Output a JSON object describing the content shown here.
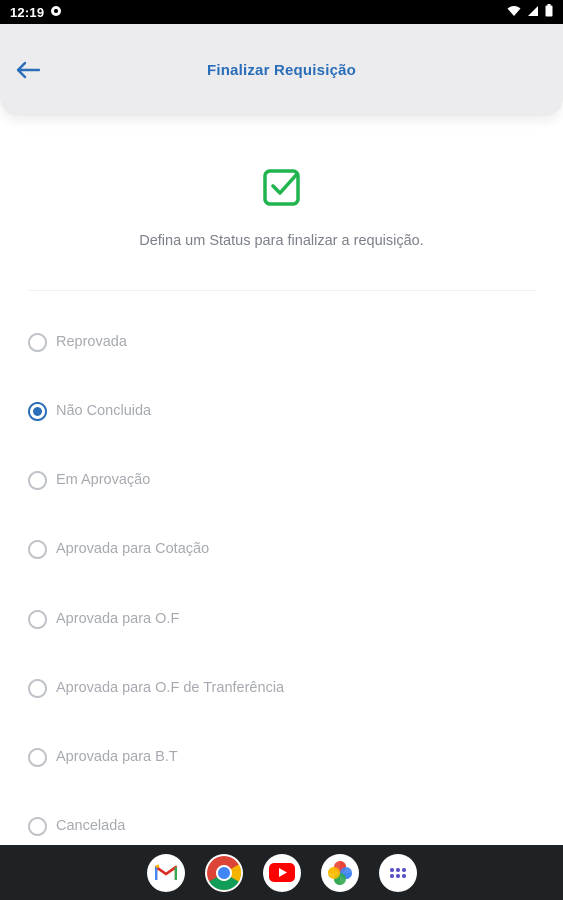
{
  "status_bar": {
    "time": "12:19"
  },
  "app_bar": {
    "title": "Finalizar Requisição"
  },
  "main": {
    "subtitle": "Defina um Status para finalizar a requisição.",
    "accent_color": "#2a6db8",
    "success_color": "#1fb44e",
    "options": [
      {
        "label": "Reprovada",
        "selected": false
      },
      {
        "label": "Não Concluida",
        "selected": true
      },
      {
        "label": "Em Aprovação",
        "selected": false
      },
      {
        "label": "Aprovada para Cotação",
        "selected": false
      },
      {
        "label": "Aprovada para O.F",
        "selected": false
      },
      {
        "label": "Aprovada para O.F de Tranferência",
        "selected": false
      },
      {
        "label": "Aprovada para B.T",
        "selected": false
      },
      {
        "label": "Cancelada",
        "selected": false
      }
    ]
  },
  "dock": {
    "apps": [
      {
        "icon": "gmail-icon"
      },
      {
        "icon": "chrome-icon"
      },
      {
        "icon": "youtube-icon"
      },
      {
        "icon": "photos-icon"
      },
      {
        "icon": "app-drawer-icon"
      }
    ]
  }
}
